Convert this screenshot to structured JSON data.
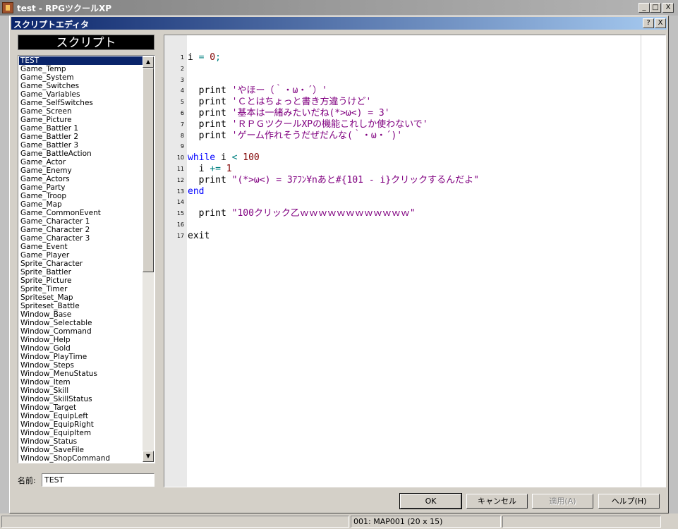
{
  "main_window": {
    "title": "test - RPGツクールXP"
  },
  "dialog": {
    "title": "スクリプトエディタ"
  },
  "caption_buttons": {
    "minimize": "_",
    "maximize": "□",
    "close": "X",
    "help": "?",
    "dlg_close": "X"
  },
  "left_panel": {
    "header": "スクリプト",
    "selected": "TEST",
    "items": [
      "TEST",
      "Game_Temp",
      "Game_System",
      "Game_Switches",
      "Game_Variables",
      "Game_SelfSwitches",
      "Game_Screen",
      "Game_Picture",
      "Game_Battler 1",
      "Game_Battler 2",
      "Game_Battler 3",
      "Game_BattleAction",
      "Game_Actor",
      "Game_Enemy",
      "Game_Actors",
      "Game_Party",
      "Game_Troop",
      "Game_Map",
      "Game_CommonEvent",
      "Game_Character 1",
      "Game_Character 2",
      "Game_Character 3",
      "Game_Event",
      "Game_Player",
      "Sprite_Character",
      "Sprite_Battler",
      "Sprite_Picture",
      "Sprite_Timer",
      "Spriteset_Map",
      "Spriteset_Battle",
      "Window_Base",
      "Window_Selectable",
      "Window_Command",
      "Window_Help",
      "Window_Gold",
      "Window_PlayTime",
      "Window_Steps",
      "Window_MenuStatus",
      "Window_Item",
      "Window_Skill",
      "Window_SkillStatus",
      "Window_Target",
      "Window_EquipLeft",
      "Window_EquipRight",
      "Window_EquipItem",
      "Window_Status",
      "Window_SaveFile",
      "Window_ShopCommand"
    ],
    "name_label": "名前:",
    "name_value": "TEST"
  },
  "editor": {
    "lines": [
      {
        "n": "1",
        "tokens": [
          [
            "id",
            "i "
          ],
          [
            "op",
            "="
          ],
          [
            "num",
            " 0"
          ],
          [
            "op",
            ";"
          ]
        ]
      },
      {
        "n": "2",
        "tokens": []
      },
      {
        "n": "3",
        "tokens": []
      },
      {
        "n": "4",
        "tokens": [
          [
            "id",
            "  print "
          ],
          [
            "str",
            "'やほー（｀・ω・´）'"
          ]
        ]
      },
      {
        "n": "5",
        "tokens": [
          [
            "id",
            "  print "
          ],
          [
            "str",
            "'Ｃとはちょっと書き方違うけど'"
          ]
        ]
      },
      {
        "n": "6",
        "tokens": [
          [
            "id",
            "  print "
          ],
          [
            "str",
            "'基本は一緒みたいだね(*>ω<) = 3'"
          ]
        ]
      },
      {
        "n": "7",
        "tokens": [
          [
            "id",
            "  print "
          ],
          [
            "str",
            "'ＲＰＧツクールXPの機能これしか使わないで'"
          ]
        ]
      },
      {
        "n": "8",
        "tokens": [
          [
            "id",
            "  print "
          ],
          [
            "str",
            "'ゲーム作れそうだぜだんな(｀・ω・´)'"
          ]
        ]
      },
      {
        "n": "9",
        "tokens": []
      },
      {
        "n": "10",
        "tokens": [
          [
            "kw",
            "while"
          ],
          [
            "id",
            " i "
          ],
          [
            "op",
            "<"
          ],
          [
            "num",
            " 100"
          ]
        ]
      },
      {
        "n": "11",
        "tokens": [
          [
            "id",
            "  i "
          ],
          [
            "op",
            "+="
          ],
          [
            "num",
            " 1"
          ]
        ]
      },
      {
        "n": "12",
        "tokens": [
          [
            "id",
            "  print "
          ],
          [
            "str",
            "\"(*>ω<) = 3ｱﾌﾝ¥nあと#{101 - i}クリックするんだよ\""
          ]
        ]
      },
      {
        "n": "13",
        "tokens": [
          [
            "kw",
            "end"
          ]
        ]
      },
      {
        "n": "14",
        "tokens": []
      },
      {
        "n": "15",
        "tokens": [
          [
            "id",
            "  print "
          ],
          [
            "str",
            "\"100クリック乙ｗｗｗｗｗｗｗｗｗｗｗｗ\""
          ]
        ]
      },
      {
        "n": "16",
        "tokens": []
      },
      {
        "n": "17",
        "tokens": [
          [
            "id",
            "exit"
          ]
        ]
      }
    ]
  },
  "buttons": {
    "ok": "OK",
    "cancel": "キャンセル",
    "apply": "適用(A)",
    "help": "ヘルプ(H)"
  },
  "statusbar": {
    "map": "001: MAP001 (20 x 15)"
  },
  "colors": {
    "keyword": "#0000ff",
    "string": "#800080",
    "number": "#800000",
    "operator": "#008080",
    "selection": "#0a246a"
  }
}
